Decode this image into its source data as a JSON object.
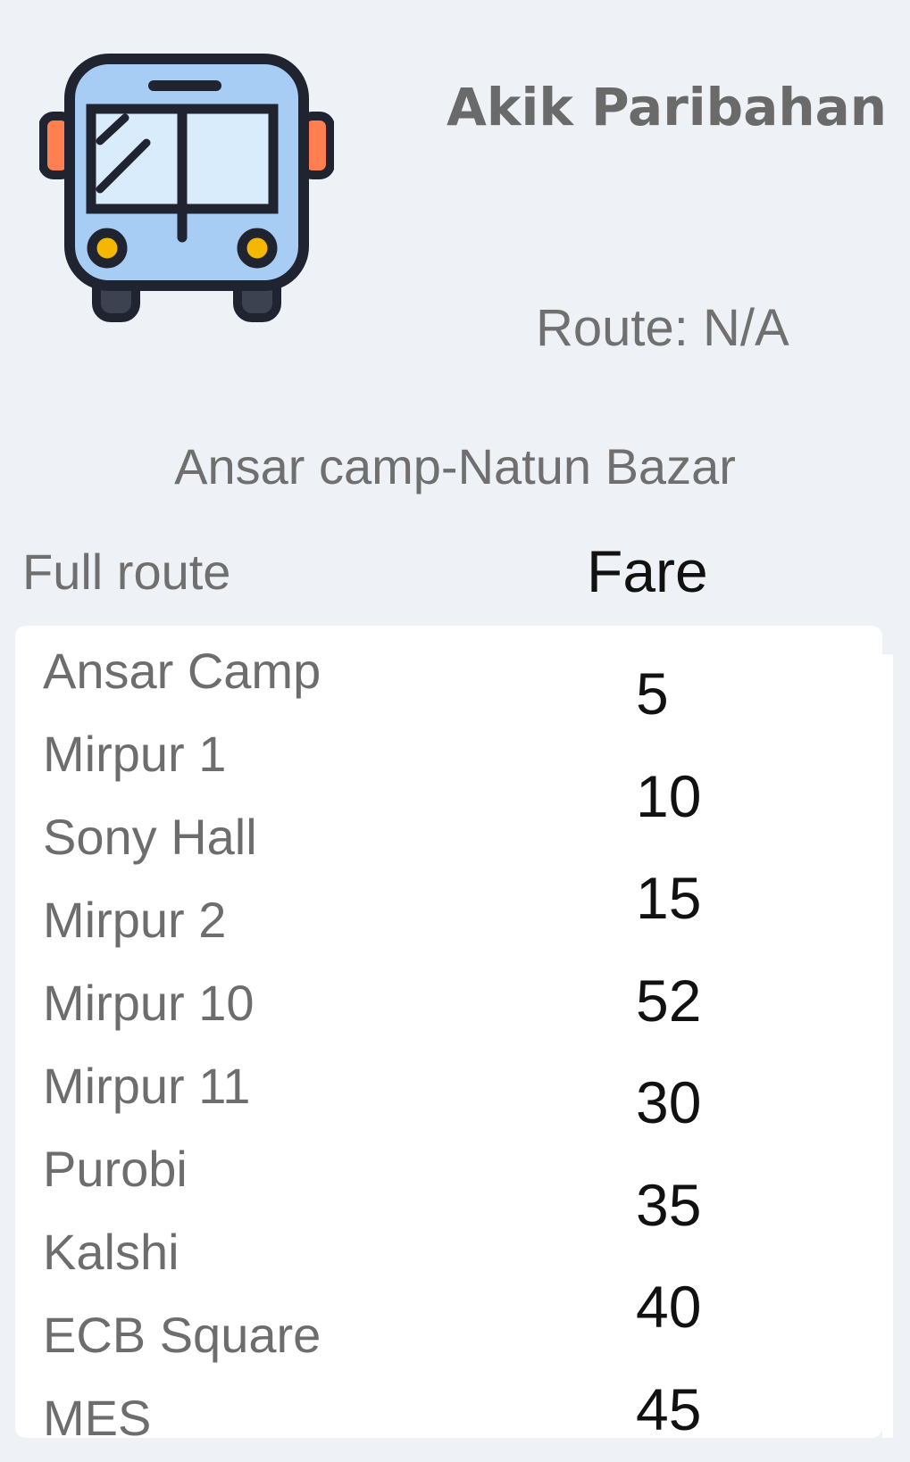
{
  "header": {
    "icon": "bus-icon",
    "operator_name": "Akik Paribahan",
    "route_code": "Route: N/A"
  },
  "route": {
    "name": "Ansar camp-Natun Bazar"
  },
  "table": {
    "headers": {
      "route": "Full route",
      "fare": "Fare"
    },
    "stops": [
      "Ansar Camp",
      "Mirpur 1",
      "Sony Hall",
      "Mirpur 2",
      "Mirpur 10",
      "Mirpur 11",
      "Purobi",
      "Kalshi",
      "ECB Square",
      "MES"
    ],
    "fares": [
      "5",
      "10",
      "15",
      "52",
      "30",
      "35",
      "40",
      "45"
    ]
  },
  "colors": {
    "background": "#eef1f6",
    "card": "#ffffff",
    "bus_body": "#a8cdf5",
    "bus_window": "#d9ecfb",
    "bus_mirror": "#ff7f50",
    "bus_light": "#f5b700",
    "outline": "#1f2430"
  }
}
